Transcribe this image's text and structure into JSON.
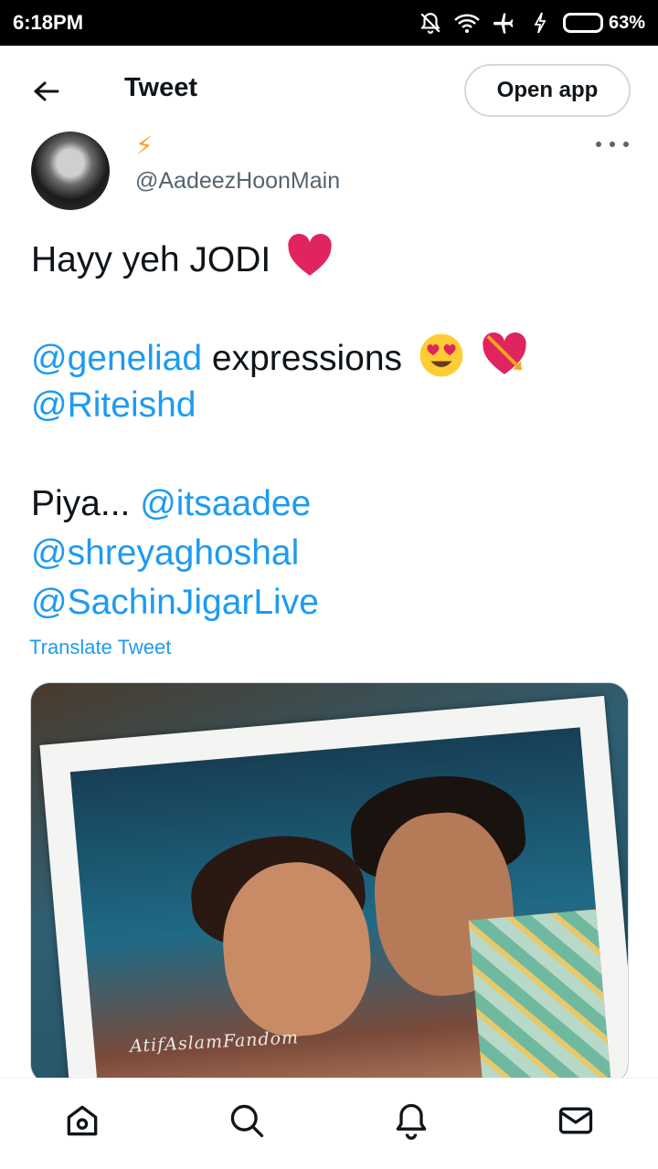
{
  "status_bar": {
    "time": "6:18PM",
    "battery_percent": "63%",
    "battery_level": 0.63,
    "icons": [
      "notifications-off-icon",
      "wifi-icon",
      "airplane-icon",
      "charging-icon",
      "battery-icon"
    ]
  },
  "header": {
    "title": "Tweet",
    "open_app_label": "Open app",
    "back_icon": "back-arrow-icon"
  },
  "tweet": {
    "author_handle": "@AadeezHoonMain",
    "author_badge": "⚡",
    "text_line1": "Hayy yeh JODI",
    "mention_geneliad": "@geneliad",
    "text_expressions": "expressions",
    "mention_riteishd": "@Riteishd",
    "text_piya": "Piya...",
    "mention_itsaadee": "@itsaadee",
    "mention_shreyaghoshal": "@shreyaghoshal",
    "mention_sachinjigar": "@SachinJigarLive",
    "translate_label": "Translate Tweet",
    "media_watermark": "AtifAslamFandom"
  },
  "bottom_nav": {
    "items": [
      "home-icon",
      "search-icon",
      "notifications-icon",
      "messages-icon"
    ]
  },
  "colors": {
    "link": "#1d9bf0",
    "text": "#0f1419",
    "secondary": "#536471",
    "heart": "#e0245e"
  }
}
